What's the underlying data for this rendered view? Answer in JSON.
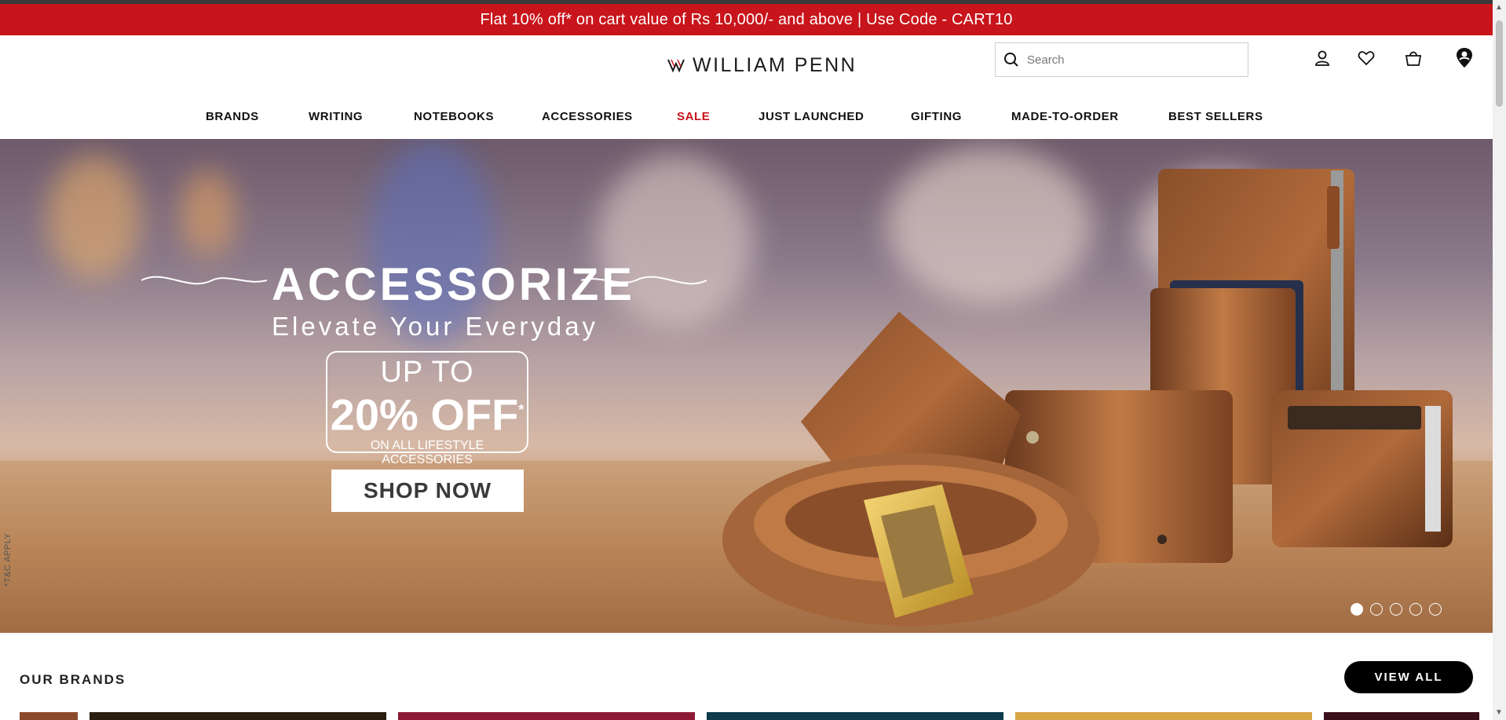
{
  "announcement": "Flat 10% off* on cart value of Rs 10,000/- and above | Use Code - CART10",
  "header": {
    "logo_text": "WILLIAM PENN",
    "search_placeholder": "Search",
    "icons": [
      "user-icon",
      "heart-icon",
      "bag-icon",
      "location-icon"
    ]
  },
  "nav": {
    "items": [
      "BRANDS",
      "WRITING",
      "NOTEBOOKS",
      "ACCESSORIES",
      "SALE",
      "JUST LAUNCHED",
      "GIFTING",
      "MADE-TO-ORDER",
      "BEST SELLERS"
    ]
  },
  "hero": {
    "headline": "ACCESSORIZE",
    "subheadline": "Elevate Your Everyday",
    "offer_upto": "UP TO",
    "offer_percent": "20% OFF",
    "offer_asterisk": "*",
    "offer_on": "ON ALL LIFESTYLE ACCESSORIES",
    "cta": "SHOP NOW",
    "disclaimer": "*T&C APPLY",
    "slides_total": 5,
    "active_slide": 1
  },
  "brands": {
    "title": "OUR BRANDS",
    "view_all": "VIEW ALL"
  },
  "colors": {
    "announcement_bg": "#c8141b",
    "sale_nav": "#c8141b",
    "button_dark": "#000000"
  }
}
